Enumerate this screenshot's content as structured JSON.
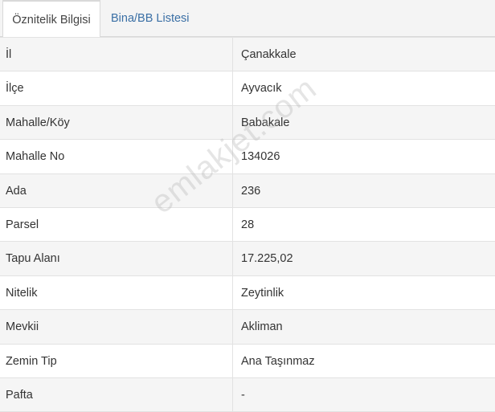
{
  "tabs": [
    {
      "label": "Öznitelik Bilgisi",
      "active": true
    },
    {
      "label": "Bina/BB Listesi",
      "active": false
    }
  ],
  "rows": [
    {
      "label": "İl",
      "value": "Çanakkale"
    },
    {
      "label": "İlçe",
      "value": "Ayvacık"
    },
    {
      "label": "Mahalle/Köy",
      "value": "Babakale"
    },
    {
      "label": "Mahalle No",
      "value": "134026"
    },
    {
      "label": "Ada",
      "value": "236"
    },
    {
      "label": "Parsel",
      "value": "28"
    },
    {
      "label": "Tapu Alanı",
      "value": "17.225,02"
    },
    {
      "label": "Nitelik",
      "value": "Zeytinlik"
    },
    {
      "label": "Mevkii",
      "value": "Akliman"
    },
    {
      "label": "Zemin Tip",
      "value": "Ana Taşınmaz"
    },
    {
      "label": "Pafta",
      "value": "-"
    }
  ],
  "watermark": "emlakjet.com",
  "colors": {
    "tab_link": "#3a6fa5",
    "row_stripe": "#f5f5f5",
    "border": "#e2e2e2"
  }
}
